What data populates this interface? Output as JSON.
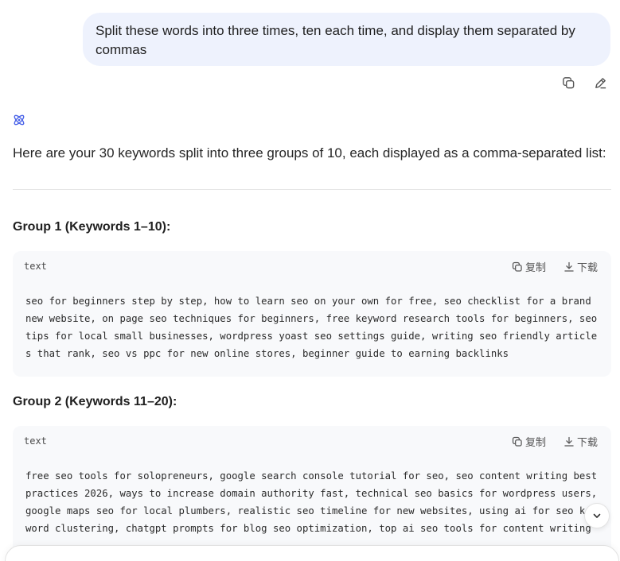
{
  "user_message": {
    "text": "Split these words into three times, ten each time, and display them separated by commas"
  },
  "message_actions": {
    "copy_icon": "copy-icon",
    "edit_icon": "pencil-icon"
  },
  "assistant": {
    "logo_icon": "atom-logo-icon",
    "intro": "Here are your 30 keywords split into three groups of 10, each displayed as a comma-separated list:",
    "groups": [
      {
        "title": "Group 1 (Keywords 1–10):",
        "lang": "text",
        "copy_label": "复制",
        "download_label": "下载",
        "code": "seo for beginners step by step, how to learn seo on your own for free, seo checklist for a brand new website, on page seo techniques for beginners, free keyword research tools for beginners, seo tips for local small businesses, wordpress yoast seo settings guide, writing seo friendly articles that rank, seo vs ppc for new online stores, beginner guide to earning backlinks"
      },
      {
        "title": "Group 2 (Keywords 11–20):",
        "lang": "text",
        "copy_label": "复制",
        "download_label": "下载",
        "code": "free seo tools for solopreneurs, google search console tutorial for seo, seo content writing best practices 2026, ways to increase domain authority fast, technical seo basics for wordpress users, google maps seo for local plumbers, realistic seo timeline for new websites, using ai for seo keyword clustering, chatgpt prompts for blog seo optimization, top ai seo tools for content writing"
      }
    ]
  },
  "colors": {
    "user_bubble": "#eef2fd",
    "code_bg": "#f8f9fb",
    "logo": "#4a63e8"
  },
  "scroll_button": {
    "icon": "chevron-down-icon"
  }
}
